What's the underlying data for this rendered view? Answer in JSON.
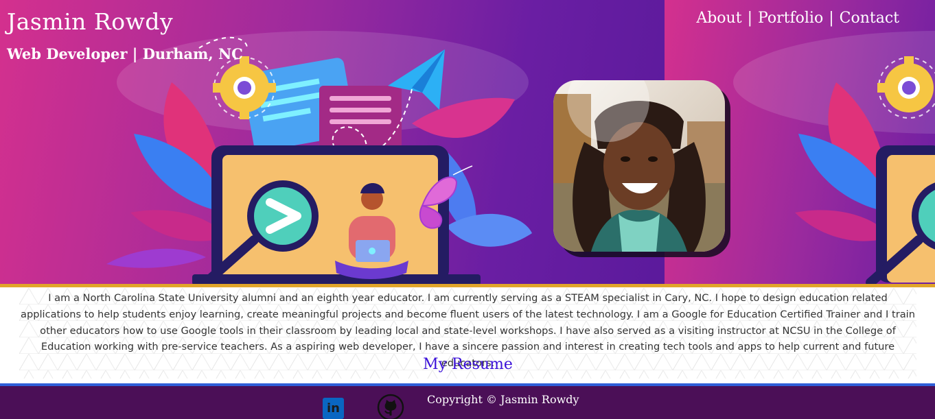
{
  "header": {
    "name": "Jasmin Rowdy",
    "tagline": "Web Developer | Durham, NC"
  },
  "nav": {
    "items": [
      {
        "label": "About"
      },
      {
        "label": "Portfolio"
      },
      {
        "label": "Contact"
      }
    ],
    "separator": "|"
  },
  "about": {
    "text": "I am a North Carolina State University alumni and an eighth year educator. I am currently serving as a STEAM specialist in Cary, NC. I hope to design education related applications to help students enjoy learning, create meaningful projects and become fluent users of the latest technology. I am a Google for Education Certified Trainer and I train other educators how to use Google tools in their classroom by leading local and state-level workshops. I have also served as a visiting instructor at NCSU in the College of Education working with pre-service teachers. As a aspiring web developer, I have a sincere passion and interest in creating tech tools and apps to help current and future educators.",
    "resume_label": "My Resume"
  },
  "footer": {
    "linkedin_glyph": "in",
    "copyright": "Copyright © Jasmin Rowdy"
  },
  "icons": {
    "linkedin": "linkedin-icon",
    "github": "github-icon"
  },
  "colors": {
    "hero_pink": "#d4308e",
    "hero_purple": "#5b1a9c",
    "accent_gold": "#e1a52a",
    "resume_link": "#3a10d8",
    "footer_bg": "#4b0f57",
    "footer_line": "#2f5fd8"
  }
}
